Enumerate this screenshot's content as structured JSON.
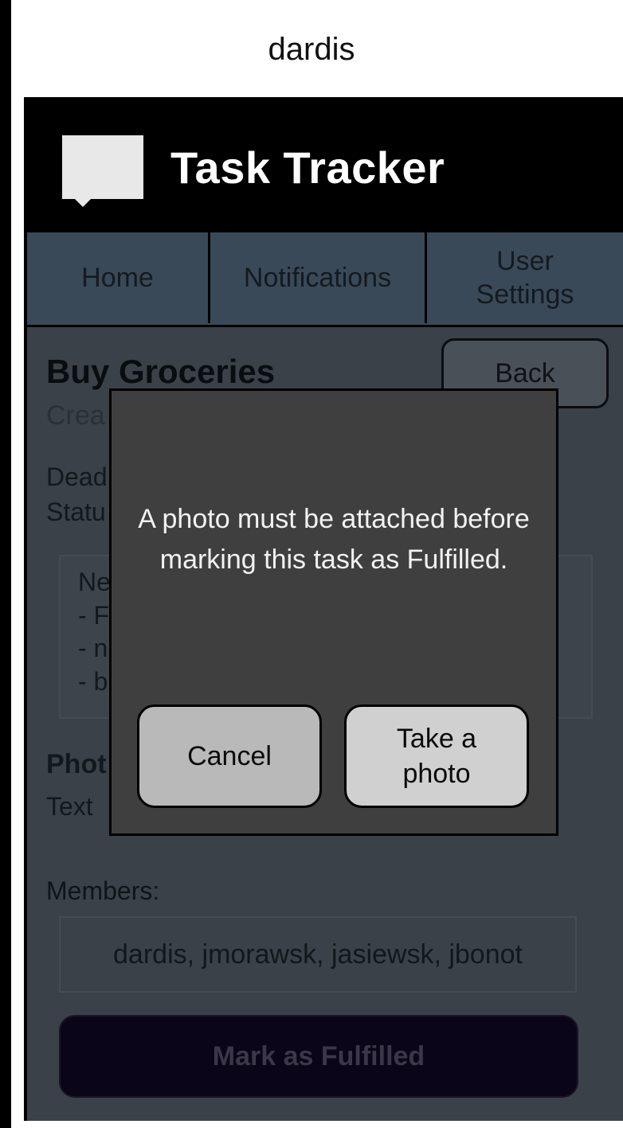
{
  "user": {
    "name": "dardis"
  },
  "app": {
    "title": "Task Tracker"
  },
  "nav": {
    "home": "Home",
    "notifications": "Notifications",
    "user_settings_line1": "User",
    "user_settings_line2": "Settings"
  },
  "task": {
    "title": "Buy Groceries",
    "created_partial": "Crea",
    "deadline_partial": "Dead",
    "status_partial": "Statu",
    "description_lines": [
      "Ne",
      "- F",
      "- n",
      "- b"
    ],
    "photo_label_partial": "Phot",
    "photo_text_partial": "Text",
    "members_label": "Members:",
    "members_value": "dardis, jmorawsk, jasiewsk, jbonot",
    "fulfill_button": "Mark as Fulfilled",
    "back_button": "Back"
  },
  "modal": {
    "message": "A photo must be attached before marking this task as Fulfilled.",
    "cancel": "Cancel",
    "take_photo_line1": "Take a",
    "take_photo_line2": "photo"
  }
}
